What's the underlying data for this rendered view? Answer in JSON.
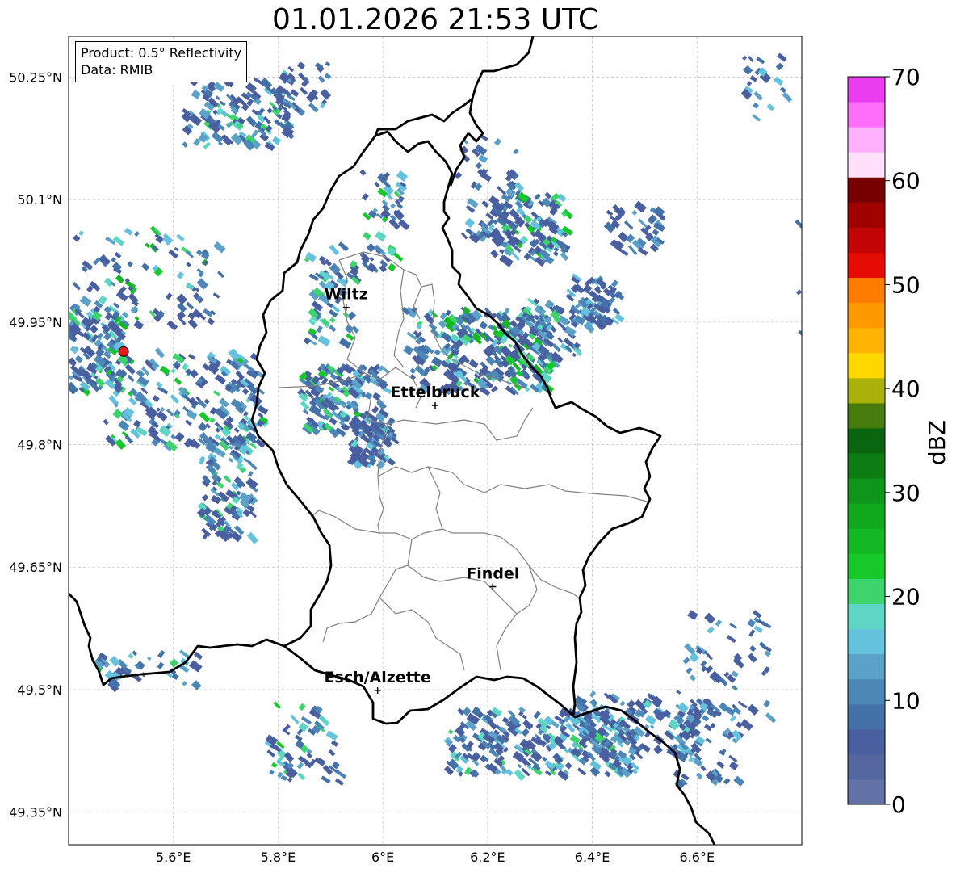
{
  "title": "01.01.2026 21:53 UTC",
  "info_box": {
    "product": "Product: 0.5° Reflectivity",
    "data": "Data: RMIB"
  },
  "map": {
    "lon_range": [
      5.4,
      6.8
    ],
    "lat_range": [
      49.31,
      50.3
    ],
    "x_ticks": [
      {
        "value": 5.6,
        "label": "5.6°E"
      },
      {
        "value": 5.8,
        "label": "5.8°E"
      },
      {
        "value": 6.0,
        "label": "6°E"
      },
      {
        "value": 6.2,
        "label": "6.2°E"
      },
      {
        "value": 6.4,
        "label": "6.4°E"
      },
      {
        "value": 6.6,
        "label": "6.6°E"
      }
    ],
    "y_ticks": [
      {
        "value": 50.25,
        "label": "50.25°N"
      },
      {
        "value": 50.1,
        "label": "50.1°N"
      },
      {
        "value": 49.95,
        "label": "49.95°N"
      },
      {
        "value": 49.8,
        "label": "49.8°N"
      },
      {
        "value": 49.65,
        "label": "49.65°N"
      },
      {
        "value": 49.5,
        "label": "49.5°N"
      },
      {
        "value": 49.35,
        "label": "49.35°N"
      }
    ],
    "cities": [
      {
        "name": "Wiltz",
        "lon": 5.93,
        "lat": 49.968
      },
      {
        "name": "Ettelbruck",
        "lon": 6.1,
        "lat": 49.848
      },
      {
        "name": "Findel",
        "lon": 6.21,
        "lat": 49.626
      },
      {
        "name": "Esch/Alzette",
        "lon": 5.99,
        "lat": 49.499
      }
    ],
    "radar_site": {
      "lon": 5.505,
      "lat": 49.914,
      "color": "#e41a1c"
    }
  },
  "colorbar": {
    "label": "dBZ",
    "min": 0,
    "max": 70,
    "ticks": [
      "0",
      "10",
      "20",
      "30",
      "40",
      "50",
      "60",
      "70"
    ],
    "colors": [
      "#6272a6",
      "#53669e",
      "#4a5fa0",
      "#4472a8",
      "#4c87b8",
      "#5ba1c8",
      "#64c2dc",
      "#5ed6c5",
      "#3dd46c",
      "#16c82a",
      "#14b824",
      "#12a81e",
      "#0f961a",
      "#0c7c13",
      "#0a6510",
      "#477c0f",
      "#aab10a",
      "#fed700",
      "#ffb404",
      "#fe9a00",
      "#fe7c00",
      "#e60b03",
      "#c40505",
      "#a00101",
      "#770000",
      "#ffe0fa",
      "#ffb1fd",
      "#ff6ef9",
      "#ea3df0"
    ]
  }
}
